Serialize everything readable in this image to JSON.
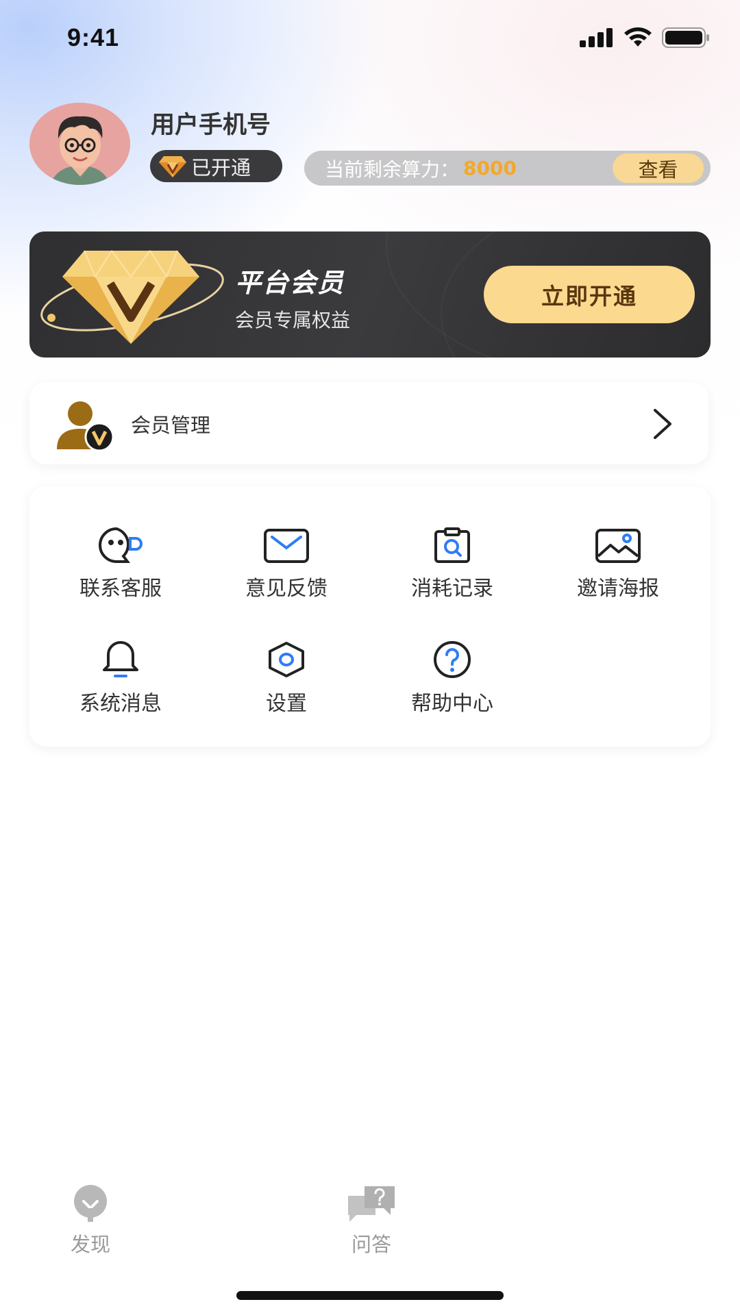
{
  "status_bar": {
    "time": "9:41"
  },
  "profile": {
    "username": "用户手机号",
    "vip_status": "已开通",
    "compute_label": "当前剩余算力：",
    "compute_value": "8000",
    "view_button": "查看"
  },
  "banner": {
    "title": "平台会员",
    "subtitle": "会员专属权益",
    "open_button": "立即开通"
  },
  "member_manage": {
    "label": "会员管理"
  },
  "grid": {
    "items": [
      {
        "label": "联系客服",
        "icon": "customer-service-icon"
      },
      {
        "label": "意见反馈",
        "icon": "mail-icon"
      },
      {
        "label": "消耗记录",
        "icon": "clipboard-search-icon"
      },
      {
        "label": "邀请海报",
        "icon": "image-icon"
      },
      {
        "label": "系统消息",
        "icon": "bell-icon"
      },
      {
        "label": "设置",
        "icon": "settings-hexagon-icon"
      },
      {
        "label": "帮助中心",
        "icon": "help-circle-icon"
      }
    ]
  },
  "tabbar": {
    "tabs": [
      {
        "label": "发现",
        "icon": "bulb-icon"
      },
      {
        "label": "问答",
        "icon": "chat-question-icon"
      }
    ]
  },
  "colors": {
    "accent_blue": "#2f7cf6",
    "gold": "#fbd98f",
    "dark": "#333333",
    "compute_value": "#f3a82a"
  }
}
